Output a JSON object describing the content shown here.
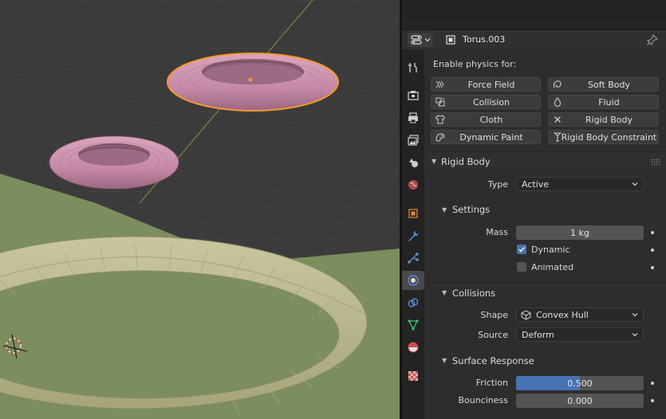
{
  "header": {
    "object_name": "Torus.003",
    "editor_icon": "properties-editor-icon",
    "pin_icon": "pin-icon"
  },
  "tabs": [
    {
      "name": "tool",
      "icon": "wrench-screwdriver-icon"
    },
    {
      "name": "render",
      "icon": "camera-back-icon"
    },
    {
      "name": "output",
      "icon": "printer-icon"
    },
    {
      "name": "view-layer",
      "icon": "image-stack-icon"
    },
    {
      "name": "scene",
      "icon": "scene-icon"
    },
    {
      "name": "world",
      "icon": "world-icon"
    },
    {
      "name": "object",
      "icon": "object-square-icon"
    },
    {
      "name": "modifiers",
      "icon": "wrench-icon"
    },
    {
      "name": "particles",
      "icon": "particles-icon"
    },
    {
      "name": "physics",
      "icon": "physics-orbit-icon",
      "active": true
    },
    {
      "name": "constraints",
      "icon": "constraint-icon"
    },
    {
      "name": "data",
      "icon": "mesh-triangle-icon"
    },
    {
      "name": "material",
      "icon": "material-sphere-icon"
    },
    {
      "name": "texture",
      "icon": "checker-texture-icon"
    }
  ],
  "physics": {
    "enable_label": "Enable physics for:",
    "buttons": [
      {
        "label": "Force Field",
        "icon": "force-field-icon"
      },
      {
        "label": "Soft Body",
        "icon": "soft-body-icon"
      },
      {
        "label": "Collision",
        "icon": "collision-icon"
      },
      {
        "label": "Fluid",
        "icon": "fluid-drop-icon"
      },
      {
        "label": "Cloth",
        "icon": "cloth-shirt-icon"
      },
      {
        "label": "Rigid Body",
        "icon": "close-x-icon"
      },
      {
        "label": "Dynamic Paint",
        "icon": "dynamic-paint-icon"
      },
      {
        "label": "Rigid Body Constraint",
        "icon": "rigid-constraint-icon"
      }
    ]
  },
  "rigid_body": {
    "title": "Rigid Body",
    "type_label": "Type",
    "type_value": "Active",
    "settings": {
      "title": "Settings",
      "mass_label": "Mass",
      "mass_value": "1 kg",
      "dynamic_label": "Dynamic",
      "dynamic_checked": true,
      "animated_label": "Animated",
      "animated_checked": false
    },
    "collisions": {
      "title": "Collisions",
      "shape_label": "Shape",
      "shape_value": "Convex Hull",
      "shape_icon": "convex-hull-icon",
      "source_label": "Source",
      "source_value": "Deform"
    },
    "surface_response": {
      "title": "Surface Response",
      "friction_label": "Friction",
      "friction_value": "0.500",
      "friction_fraction": 0.5,
      "bounciness_label": "Bounciness",
      "bounciness_value": "0.000",
      "bounciness_fraction": 0.0
    }
  },
  "colors": {
    "accent": "#4772b3",
    "selection_outline": "#f59a2e",
    "torus_pink": "#c98aa8",
    "ground_green": "#7d8f5f"
  }
}
